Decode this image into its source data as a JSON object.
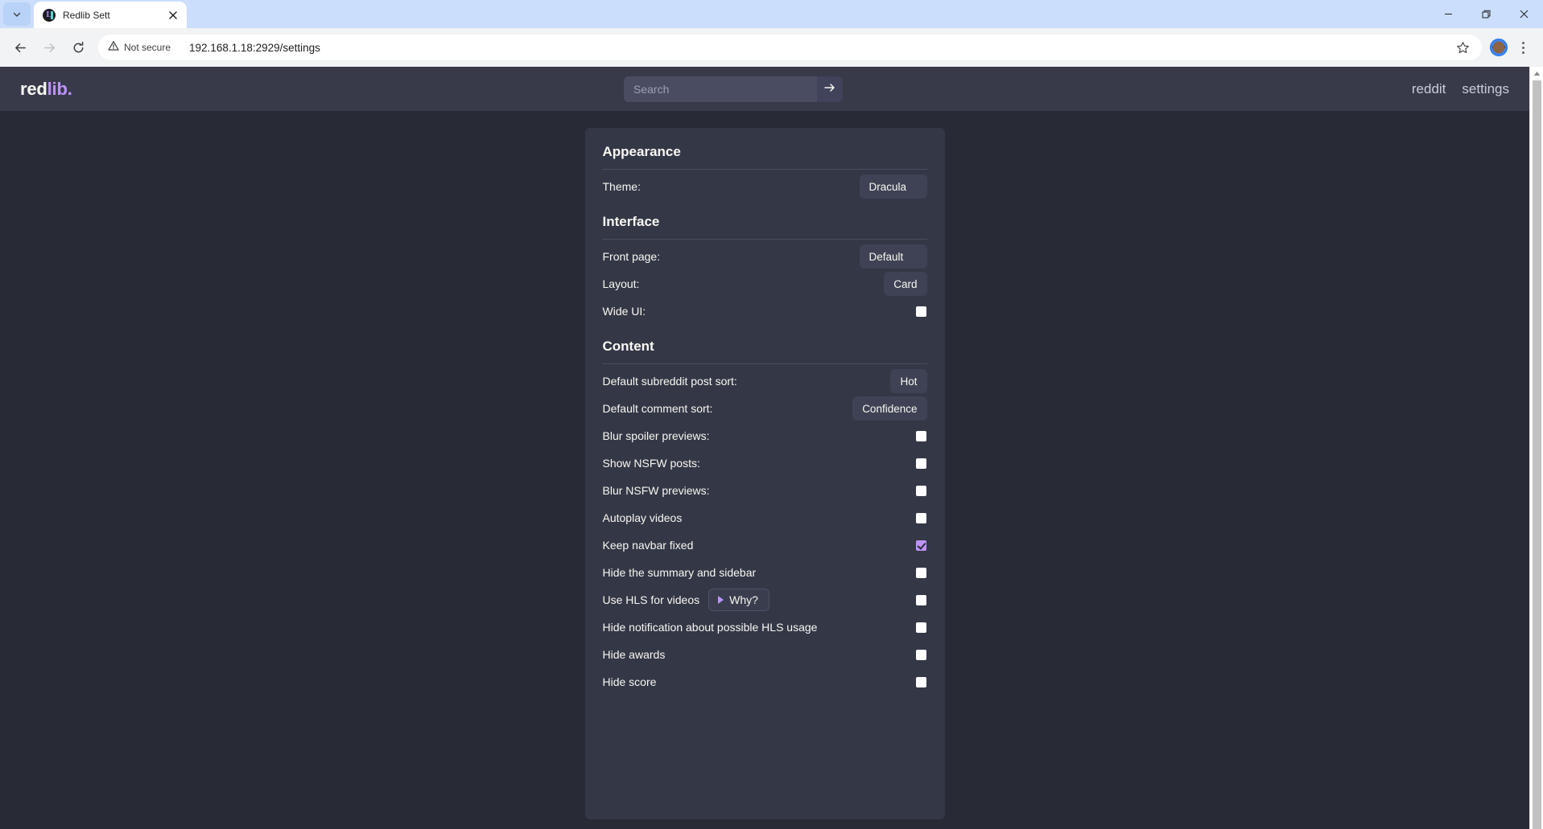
{
  "browser": {
    "tab": {
      "title": "Redlib Sett",
      "favicon": "redlib-favicon"
    },
    "tab_list_icon": "chevron-down-icon",
    "close_tab_icon": "close-icon",
    "window": {
      "minimize": "minimize-icon",
      "restore": "restore-icon",
      "close": "close-icon"
    },
    "nav": {
      "back": "back-arrow-icon",
      "forward": "forward-arrow-icon",
      "reload": "reload-icon"
    },
    "omnibox": {
      "security_icon": "warning-triangle-icon",
      "security_label": "Not secure",
      "url": "192.168.1.18:2929/settings",
      "bookmark_icon": "star-icon"
    },
    "toolbar_right": {
      "avatar": "profile-avatar",
      "menu_icon": "kebab-menu-icon"
    }
  },
  "site": {
    "logo": {
      "part1": "red",
      "part2": "lib."
    },
    "search": {
      "placeholder": "Search",
      "value": "",
      "submit_icon": "arrow-right-icon"
    },
    "nav_links": [
      {
        "label": "reddit",
        "name": "nav-link-reddit"
      },
      {
        "label": "settings",
        "name": "nav-link-settings"
      }
    ]
  },
  "settings": {
    "sections": [
      {
        "title": "Appearance",
        "rows": [
          {
            "label": "Theme:",
            "type": "select",
            "value": "Dracula",
            "name": "theme"
          }
        ]
      },
      {
        "title": "Interface",
        "rows": [
          {
            "label": "Front page:",
            "type": "select",
            "value": "Default",
            "name": "front-page"
          },
          {
            "label": "Layout:",
            "type": "select",
            "value": "Card",
            "name": "layout"
          },
          {
            "label": "Wide UI:",
            "type": "checkbox",
            "checked": false,
            "name": "wide-ui"
          }
        ]
      },
      {
        "title": "Content",
        "rows": [
          {
            "label": "Default subreddit post sort:",
            "type": "select",
            "value": "Hot",
            "name": "default-subreddit-post-sort"
          },
          {
            "label": "Default comment sort:",
            "type": "select",
            "value": "Confidence",
            "name": "default-comment-sort"
          },
          {
            "label": "Blur spoiler previews:",
            "type": "checkbox",
            "checked": false,
            "name": "blur-spoiler-previews"
          },
          {
            "label": "Show NSFW posts:",
            "type": "checkbox",
            "checked": false,
            "name": "show-nsfw-posts"
          },
          {
            "label": "Blur NSFW previews:",
            "type": "checkbox",
            "checked": false,
            "name": "blur-nsfw-previews"
          },
          {
            "label": "Autoplay videos",
            "type": "checkbox",
            "checked": false,
            "name": "autoplay-videos"
          },
          {
            "label": "Keep navbar fixed",
            "type": "checkbox",
            "checked": true,
            "name": "keep-navbar-fixed"
          },
          {
            "label": "Hide the summary and sidebar",
            "type": "checkbox",
            "checked": false,
            "name": "hide-summary-and-sidebar"
          },
          {
            "label": "Use HLS for videos",
            "type": "checkbox",
            "checked": false,
            "name": "use-hls-for-videos",
            "details": "Why?"
          },
          {
            "label": "Hide notification about possible HLS usage",
            "type": "checkbox",
            "checked": false,
            "name": "hide-hls-notification"
          },
          {
            "label": "Hide awards",
            "type": "checkbox",
            "checked": false,
            "name": "hide-awards"
          },
          {
            "label": "Hide score",
            "type": "checkbox",
            "checked": false,
            "name": "hide-score"
          }
        ]
      }
    ]
  },
  "colors": {
    "accent": "#bd93f9",
    "page_bg": "#282a36",
    "card_bg": "#343746",
    "nav_bg": "#383a4a",
    "text": "#f8f8f2"
  }
}
